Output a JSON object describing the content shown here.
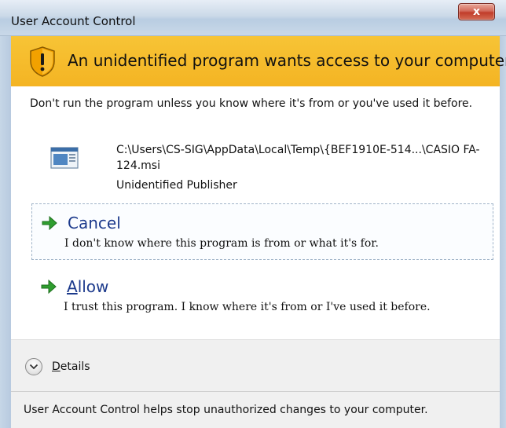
{
  "window": {
    "title": "User Account Control",
    "close_label": "x"
  },
  "banner": {
    "icon": "warning-shield-icon",
    "headline": "An unidentified program wants access to your computer",
    "color": "#f5b82a"
  },
  "content": {
    "warning_text": "Don't run the program unless you know where it's from or you've used it before.",
    "program": {
      "icon": "program-file-icon",
      "path": "C:\\Users\\CS-SIG\\AppData\\Local\\Temp\\{BEF1910E-514...\\CASIO FA-124.msi",
      "publisher": "Unidentified Publisher"
    }
  },
  "options": {
    "cancel": {
      "title": "Cancel",
      "description": "I don't know where this program is from or what it's for.",
      "icon": "green-arrow-icon"
    },
    "allow": {
      "title_underlined": "A",
      "title_rest": "llow",
      "description": "I trust this program. I know where it's from or I've used it before.",
      "icon": "green-arrow-icon"
    }
  },
  "details": {
    "label_underlined": "D",
    "label_rest": "etails",
    "icon": "chevron-down-icon"
  },
  "footer": {
    "text": "User Account Control helps stop unauthorized changes to your computer."
  }
}
